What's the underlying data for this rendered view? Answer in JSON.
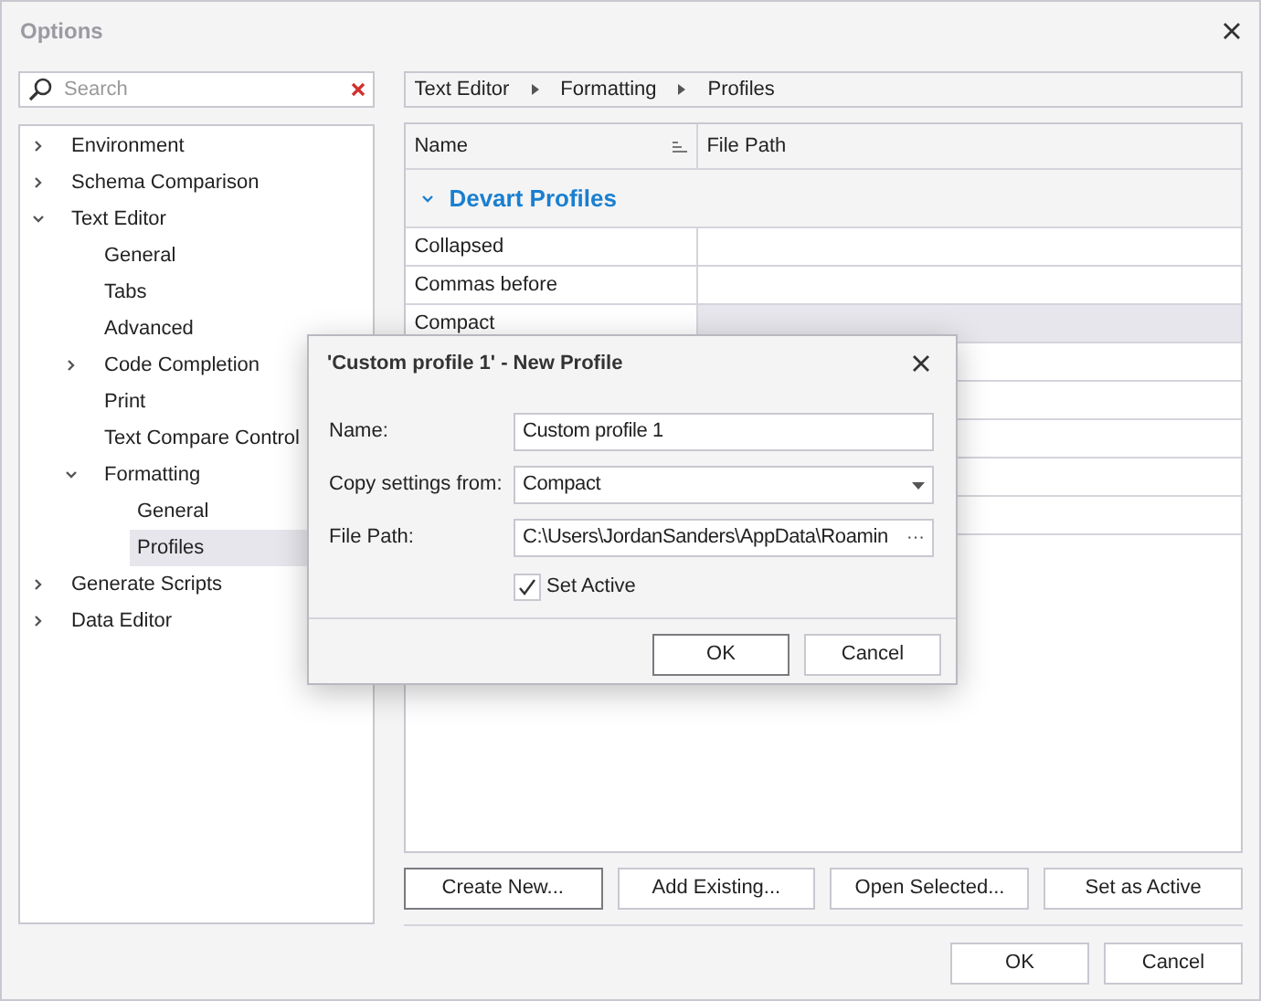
{
  "window": {
    "title": "Options"
  },
  "search": {
    "placeholder": "Search"
  },
  "tree": [
    {
      "label": "Environment",
      "expanded": false,
      "selected": false
    },
    {
      "label": "Schema Comparison",
      "expanded": false,
      "selected": false
    },
    {
      "label": "Text Editor",
      "expanded": true,
      "selected": false,
      "children": [
        {
          "label": "General",
          "selected": false
        },
        {
          "label": "Tabs",
          "selected": false
        },
        {
          "label": "Advanced",
          "selected": false
        },
        {
          "label": "Code Completion",
          "expanded": false,
          "selected": false
        },
        {
          "label": "Print",
          "selected": false
        },
        {
          "label": "Text Compare Control",
          "selected": false
        },
        {
          "label": "Formatting",
          "expanded": true,
          "selected": false,
          "children": [
            {
              "label": "General",
              "selected": false
            },
            {
              "label": "Profiles",
              "selected": true
            }
          ]
        }
      ]
    },
    {
      "label": "Generate Scripts",
      "expanded": false,
      "selected": false
    },
    {
      "label": "Data Editor",
      "expanded": false,
      "selected": false
    }
  ],
  "breadcrumb": [
    "Text Editor",
    "Formatting",
    "Profiles"
  ],
  "table": {
    "columns": [
      "Name",
      "File Path"
    ],
    "group": {
      "label": "Devart Profiles",
      "expanded": true
    },
    "rows": [
      {
        "name": "Collapsed",
        "selected": false
      },
      {
        "name": "Commas before",
        "selected": false
      },
      {
        "name": "Compact",
        "selected": true
      }
    ]
  },
  "actions": [
    "Create New...",
    "Add Existing...",
    "Open Selected...",
    "Set as Active"
  ],
  "buttons": [
    "OK",
    "Cancel"
  ],
  "dialog": {
    "title": "'Custom profile 1' - New Profile",
    "fields": [
      {
        "kind": "text",
        "label": "Name:",
        "value": "Custom profile 1"
      },
      {
        "kind": "dropdown",
        "label": "Copy settings from:",
        "value": "Compact"
      },
      {
        "kind": "browse",
        "label": "File Path:",
        "value": "C:\\Users\\JordanSanders\\AppData\\Roamin",
        "button": "···"
      }
    ],
    "checkbox": {
      "label": "Set Active",
      "checked": true
    },
    "buttons": [
      "OK",
      "Cancel"
    ]
  }
}
